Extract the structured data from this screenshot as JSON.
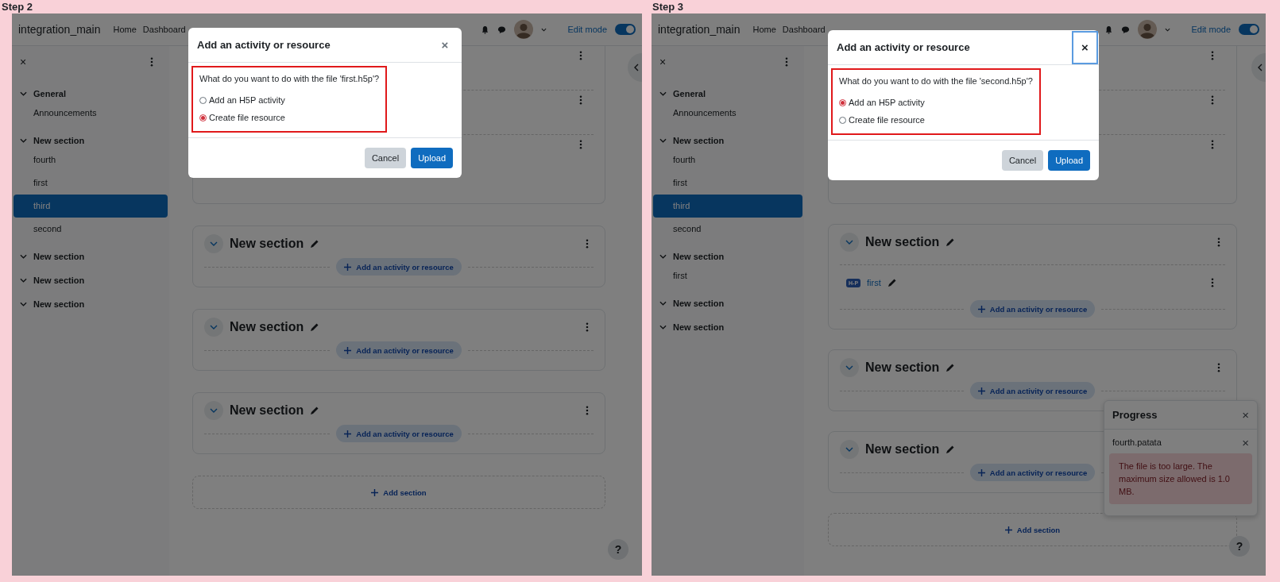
{
  "panels": [
    {
      "step": "Step 2",
      "site_name": "integration_main",
      "nav_links": [
        "Home",
        "Dashboard"
      ],
      "drawer_close": "×",
      "edit_mode": {
        "label": "Edit mode",
        "on": true
      },
      "course_index": [
        {
          "title": "General",
          "expanded": true,
          "children": [
            {
              "label": "Announcements",
              "selected": false
            }
          ]
        },
        {
          "title": "New section",
          "expanded": true,
          "children": [
            {
              "label": "fourth",
              "selected": false
            },
            {
              "label": "first",
              "selected": false
            },
            {
              "label": "third",
              "selected": true
            },
            {
              "label": "second",
              "selected": false
            }
          ]
        },
        {
          "title": "New section",
          "expanded": true
        },
        {
          "title": "New section",
          "expanded": true
        },
        {
          "title": "New section",
          "expanded": true
        }
      ],
      "sections": [
        {
          "title": "New section",
          "add_label": "Add an activity or resource"
        },
        {
          "title": "New section",
          "add_label": "Add an activity or resource"
        },
        {
          "title": "New section",
          "add_label": "Add an activity or resource"
        }
      ],
      "add_section": "Add section",
      "help": "?",
      "modal": {
        "title": "Add an activity or resource",
        "close": "×",
        "close_focused": false,
        "question": "What do you want to do with the file 'first.h5p'?",
        "options": [
          {
            "label": "Add an H5P activity",
            "selected": false
          },
          {
            "label": "Create file resource",
            "selected": true
          }
        ],
        "buttons": [
          "Cancel",
          "Upload"
        ]
      }
    },
    {
      "step": "Step 3",
      "site_name": "integration_main",
      "nav_links": [
        "Home",
        "Dashboard"
      ],
      "drawer_close": "×",
      "edit_mode": {
        "label": "Edit mode",
        "on": true
      },
      "course_index": [
        {
          "title": "General",
          "expanded": true,
          "children": [
            {
              "label": "Announcements",
              "selected": false
            }
          ]
        },
        {
          "title": "New section",
          "expanded": true,
          "children": [
            {
              "label": "fourth",
              "selected": false
            },
            {
              "label": "first",
              "selected": false
            },
            {
              "label": "third",
              "selected": true
            },
            {
              "label": "second",
              "selected": false
            }
          ]
        },
        {
          "title": "New section",
          "expanded": true,
          "children": [
            {
              "label": "first",
              "selected": false
            }
          ]
        },
        {
          "title": "New section",
          "expanded": true
        },
        {
          "title": "New section",
          "expanded": true
        }
      ],
      "sections": [
        {
          "title": "New section",
          "activities": [
            {
              "badge": "H-P",
              "name": "first"
            }
          ],
          "add_label": "Add an activity or resource"
        },
        {
          "title": "New section",
          "add_label": "Add an activity or resource"
        },
        {
          "title": "New section",
          "add_label": "Add an activity or resource"
        }
      ],
      "add_section": "Add section",
      "help": "?",
      "modal": {
        "title": "Add an activity or resource",
        "close": "×",
        "close_focused": true,
        "question": "What do you want to do with the file 'second.h5p'?",
        "options": [
          {
            "label": "Add an H5P activity",
            "selected": true
          },
          {
            "label": "Create file resource",
            "selected": false
          }
        ],
        "buttons": [
          "Cancel",
          "Upload"
        ]
      },
      "progress": {
        "title": "Progress",
        "close": "×",
        "items": [
          {
            "file": "fourth.patata",
            "close": "×",
            "error": "The file is too large. The maximum size allowed is 1.0 MB."
          }
        ]
      }
    }
  ]
}
